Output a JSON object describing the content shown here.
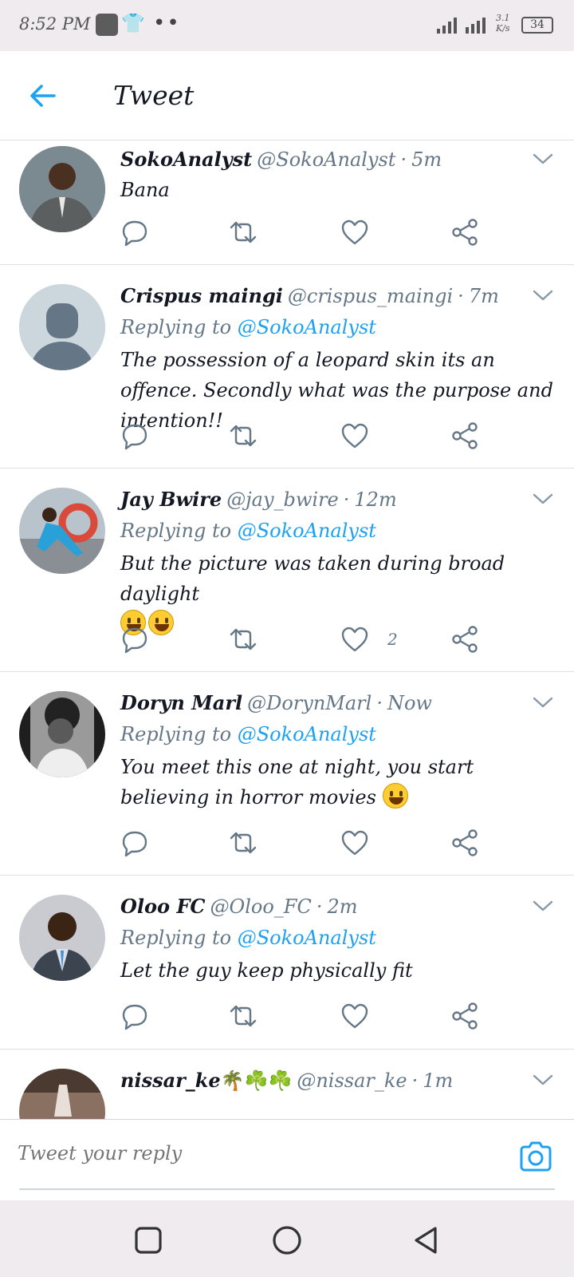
{
  "status_bar": {
    "time": "8:52 PM",
    "network_speed_value": "3.1",
    "network_speed_unit": "K/s",
    "battery": "34",
    "icons": [
      "gallery-icon",
      "shirt-icon",
      "more-dots-icon",
      "signal-icon",
      "signal-icon",
      "battery-icon"
    ]
  },
  "header": {
    "title": "Tweet",
    "back_icon": "arrow-left-icon"
  },
  "colors": {
    "accent": "#1da1f2",
    "text": "#141823",
    "secondary_text": "#657786",
    "divider": "#dcdfe3",
    "system_bar": "#efebee"
  },
  "tweets": [
    {
      "name": "SokoAnalyst",
      "handle": "@SokoAnalyst",
      "time": "5m",
      "replying_to_label": "",
      "replying_to_user": "",
      "text": "Bana",
      "likes": ""
    },
    {
      "name": "Crispus maingi",
      "handle": "@crispus_maingi",
      "time": "7m",
      "replying_to_label": "Replying to",
      "replying_to_user": "@SokoAnalyst",
      "text": "The possession of a leopard skin its an offence. Secondly what was the purpose  and intention!!",
      "likes": ""
    },
    {
      "name": "Jay Bwire",
      "handle": "@jay_bwire",
      "time": "12m",
      "replying_to_label": "Replying to",
      "replying_to_user": "@SokoAnalyst",
      "text": "But the picture was taken during broad daylight",
      "likes": "2"
    },
    {
      "name": "Doryn Marl",
      "handle": "@DorynMarl",
      "time": "Now",
      "replying_to_label": "Replying to",
      "replying_to_user": "@SokoAnalyst",
      "text": "You meet this one at night, you start believing in horror movies",
      "likes": ""
    },
    {
      "name": "Oloo FC",
      "handle": "@Oloo_FC",
      "time": "2m",
      "replying_to_label": "Replying to",
      "replying_to_user": "@SokoAnalyst",
      "text": "Let the guy keep physically fit",
      "likes": ""
    },
    {
      "name": "nissar_ke",
      "handle": "@nissar_ke",
      "time": "1m",
      "name_emojis": "🌴☘️☘️"
    }
  ],
  "action_icons": [
    "reply-icon",
    "retweet-icon",
    "like-icon",
    "share-icon"
  ],
  "reply_bar": {
    "placeholder": "Tweet your reply",
    "camera_icon": "camera-icon"
  },
  "nav_bar": {
    "icons": [
      "recent-apps-icon",
      "home-icon",
      "back-icon"
    ]
  }
}
